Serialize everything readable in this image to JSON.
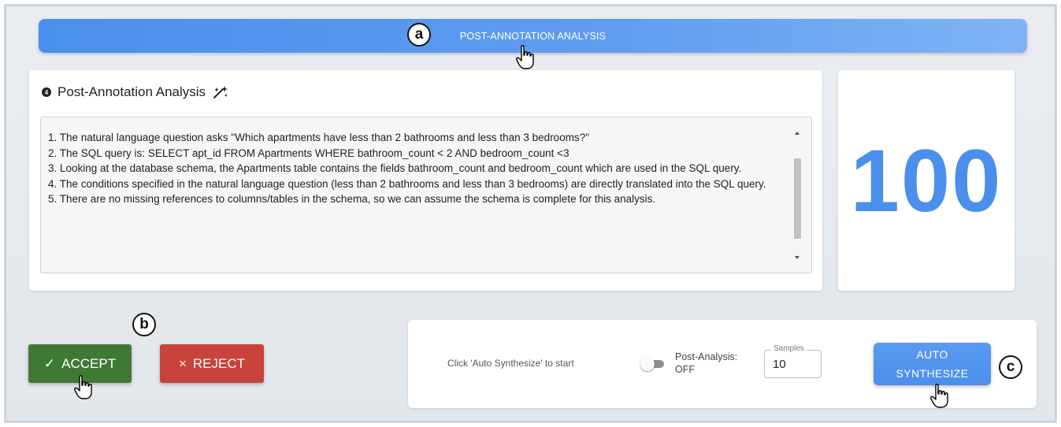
{
  "header": {
    "button_label": "POST-ANNOTATION ANALYSIS"
  },
  "callouts": {
    "a": "a",
    "b": "b",
    "c": "c"
  },
  "analysis": {
    "step_number": "4",
    "title": "Post-Annotation Analysis",
    "lines": [
      "1. The natural language question asks \"Which apartments have less than 2 bathrooms and less than 3 bedrooms?\"",
      "2. The SQL query is: SELECT apt_id FROM Apartments WHERE bathroom_count < 2 AND bedroom_count <3",
      "3. Looking at the database schema, the Apartments table contains the fields bathroom_count and bedroom_count which are used in the SQL query.",
      "4. The conditions specified in the natural language question (less than 2 bathrooms and less than 3 bedrooms) are directly translated into the SQL query.",
      "5. There are no missing references to columns/tables in the schema, so we can assume the schema is complete for this analysis."
    ]
  },
  "score": {
    "value": "100"
  },
  "actions": {
    "accept_icon": "✓",
    "accept_label": "ACCEPT",
    "reject_icon": "×",
    "reject_label": "REJECT"
  },
  "controls": {
    "hint": "Click 'Auto Synthesize' to start",
    "toggle_label_line1": "Post-Analysis:",
    "toggle_label_line2": "OFF",
    "toggle_on": false,
    "samples_legend": "Samples",
    "samples_value": "10",
    "auto_line1": "AUTO",
    "auto_line2": "SYNTHESIZE"
  },
  "colors": {
    "accent": "#4a8fec",
    "accept": "#3f7a35",
    "reject": "#c8433a"
  }
}
